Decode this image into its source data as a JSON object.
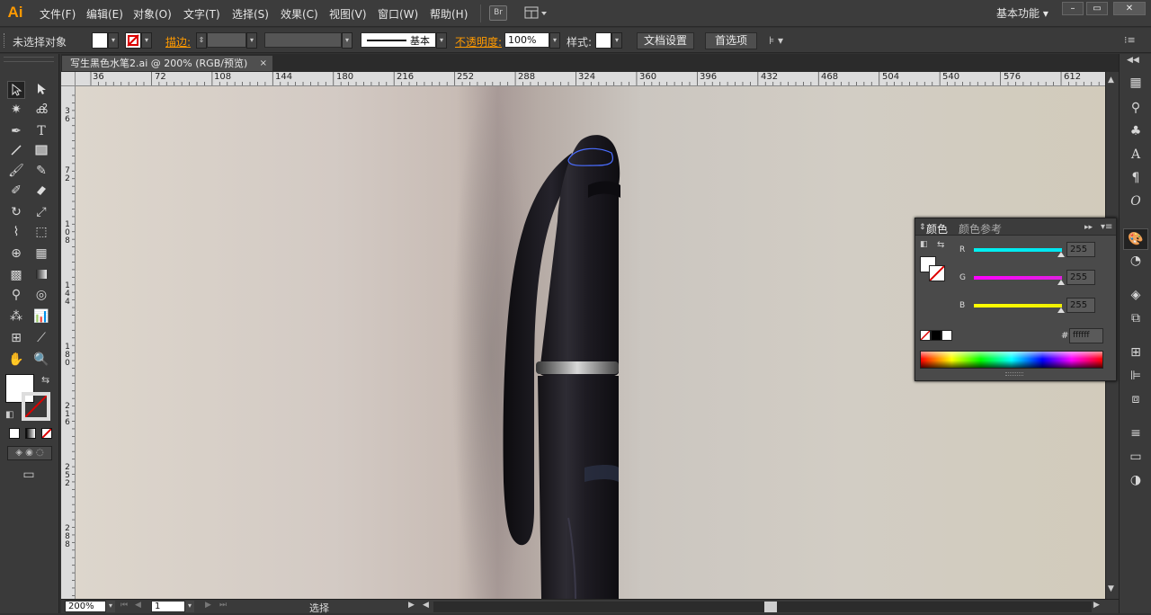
{
  "app": {
    "logo": "Ai",
    "menus": [
      "文件(F)",
      "编辑(E)",
      "对象(O)",
      "文字(T)",
      "选择(S)",
      "效果(C)",
      "视图(V)",
      "窗口(W)",
      "帮助(H)"
    ],
    "bridge_label": "Br",
    "workspace": "基本功能",
    "window_controls": [
      "–",
      "▭",
      "✕"
    ]
  },
  "control_bar": {
    "selection_status": "未选择对象",
    "stroke_label": "描边:",
    "brush_label": "基本",
    "opacity_label": "不透明度:",
    "opacity_value": "100%",
    "style_label": "样式:",
    "doc_setup_button": "文档设置",
    "preferences_button": "首选项"
  },
  "document": {
    "tab_title": "写生黑色水笔2.ai @ 200% (RGB/预览)",
    "tab_close": "×"
  },
  "rulers": {
    "top": [
      "36",
      "72",
      "108",
      "144",
      "180",
      "216",
      "252",
      "288",
      "324",
      "360",
      "396",
      "432",
      "468",
      "504",
      "540",
      "576",
      "612"
    ],
    "left": [
      "36",
      "72",
      "108",
      "144",
      "180",
      "216",
      "252",
      "288"
    ]
  },
  "status_bar": {
    "zoom": "200%",
    "page": "1",
    "tool_status": "选择"
  },
  "color_panel": {
    "tab_active": "颜色",
    "tab_inactive": "颜色参考",
    "channels": [
      {
        "name": "R",
        "value": "255",
        "color": "#00e5f0"
      },
      {
        "name": "G",
        "value": "255",
        "color": "#e020e0"
      },
      {
        "name": "B",
        "value": "255",
        "color": "#f0f000"
      }
    ],
    "hash": "#",
    "hex_value": "ffffff"
  },
  "colors": {
    "accent_orange": "#ff9a00",
    "canvas_bg": "#d2cbc4",
    "marker_body": "#1e1c22"
  }
}
